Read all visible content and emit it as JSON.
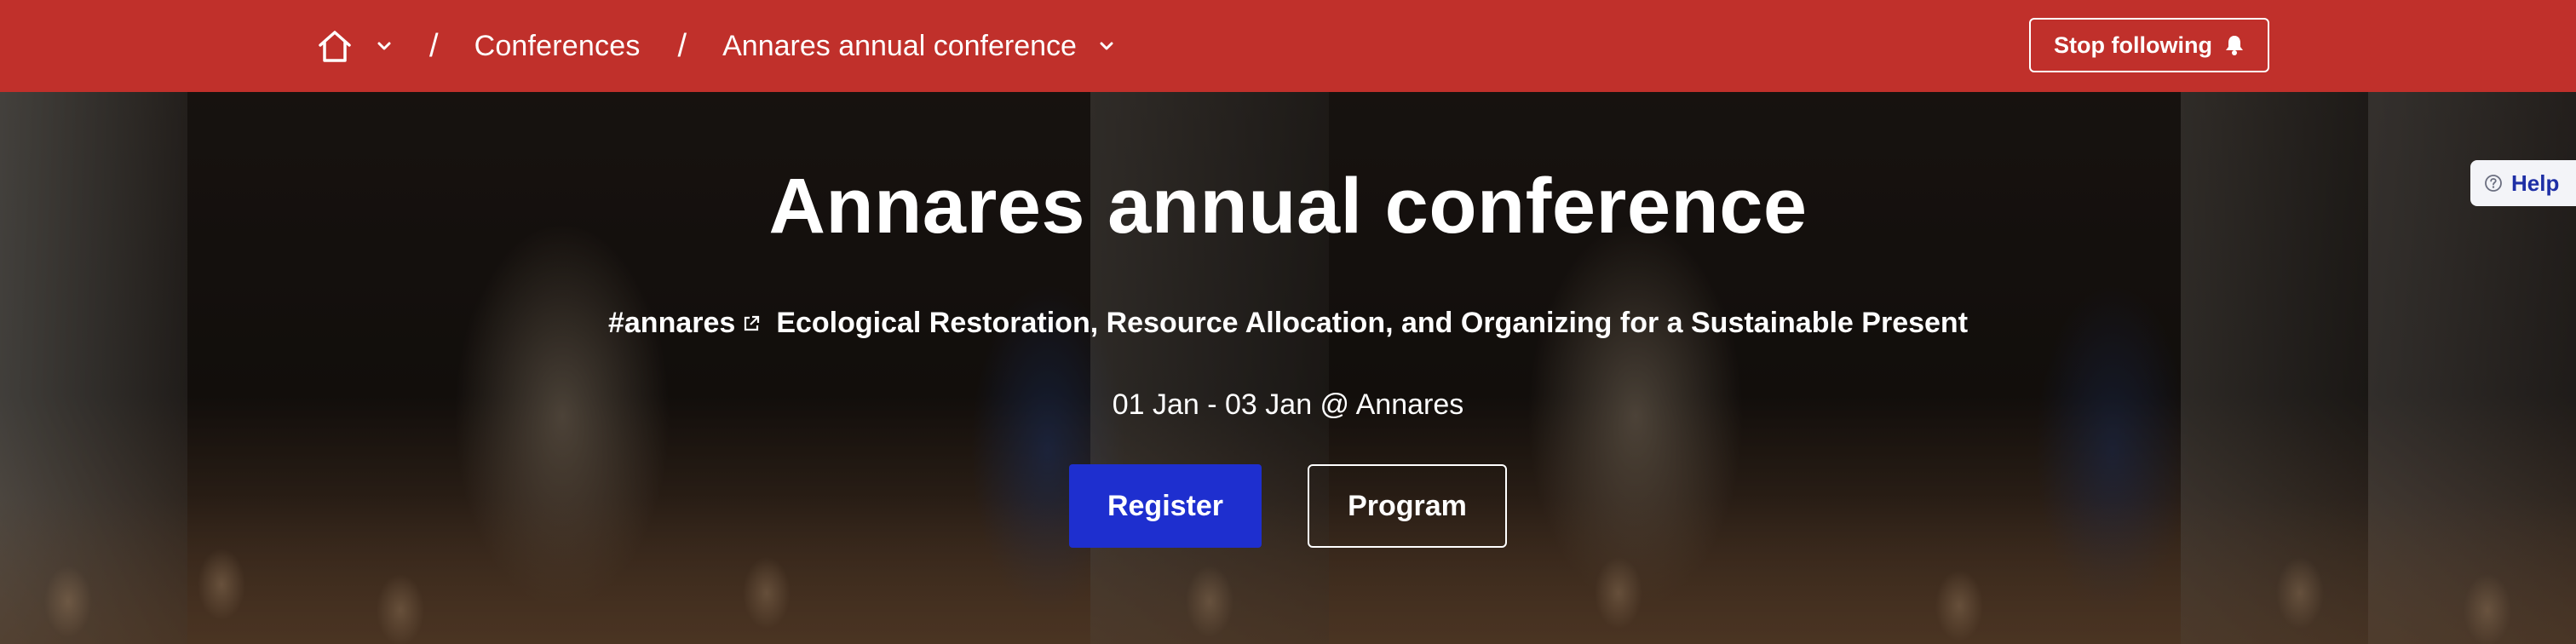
{
  "header": {
    "breadcrumb": {
      "home_icon": "home-icon",
      "menu_icon": "chevron-down-icon",
      "separator": "/",
      "items": [
        {
          "label": "Conferences"
        },
        {
          "label": "Annares annual conference"
        }
      ]
    },
    "follow_button": {
      "label": "Stop following",
      "icon": "bell-icon"
    },
    "colors": {
      "bar_background": "#c0302b"
    }
  },
  "hero": {
    "title": "Annares annual conference",
    "hashtag": "#annares",
    "hashtag_icon": "external-link-icon",
    "subtitle": "Ecological Restoration, Resource Allocation, and Organizing for a Sustainable Present",
    "date_location": "01 Jan - 03 Jan @ Annares",
    "register_label": "Register",
    "program_label": "Program",
    "colors": {
      "register_button": "#1e2fcf"
    }
  },
  "help": {
    "label": "Help",
    "icon": "question-circle-icon",
    "color": "#1e2fa6"
  }
}
